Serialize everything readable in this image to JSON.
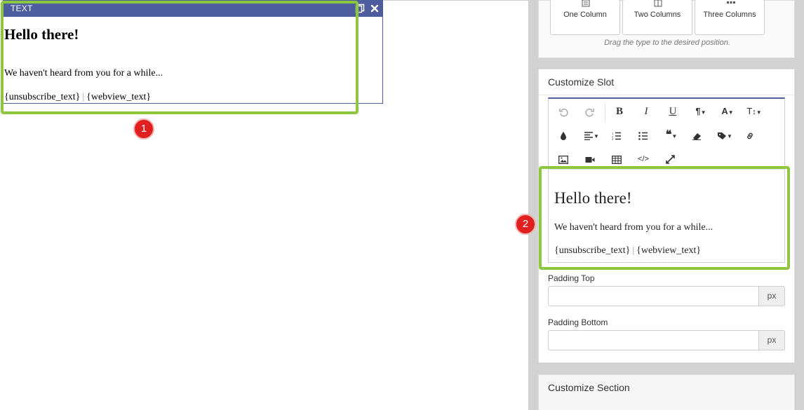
{
  "slot": {
    "type_label": "TEXT",
    "heading": "Hello there!",
    "paragraph": "We haven't heard from you for a while...",
    "link_unsubscribe": "{unsubscribe_text}",
    "separator": "|",
    "link_webview": "{webview_text}"
  },
  "callouts": [
    "1",
    "2"
  ],
  "layout": {
    "columns": [
      {
        "label": "One Column"
      },
      {
        "label": "Two Columns"
      },
      {
        "label": "Three Columns"
      }
    ],
    "hint": "Drag the type to the desired position."
  },
  "customize_slot": {
    "title": "Customize Slot",
    "toolbar": {
      "bold": "B",
      "italic": "I",
      "underline": "U",
      "paragraph": "¶",
      "font": "A",
      "font_size": "T"
    },
    "editor": {
      "heading": "Hello there!",
      "paragraph": "We haven't heard from you for a while...",
      "link_unsubscribe": "{unsubscribe_text}",
      "separator": "|",
      "link_webview": "{webview_text}"
    },
    "padding_top": {
      "label": "Padding Top",
      "value": "",
      "unit": "px"
    },
    "padding_bottom": {
      "label": "Padding Bottom",
      "value": "",
      "unit": "px"
    }
  },
  "customize_section": {
    "title": "Customize Section"
  },
  "colors": {
    "slot_header": "#4e5d9d",
    "highlight": "#8dc63f",
    "callout": "#e02020",
    "sidebar_bg": "#d2d2d2"
  }
}
